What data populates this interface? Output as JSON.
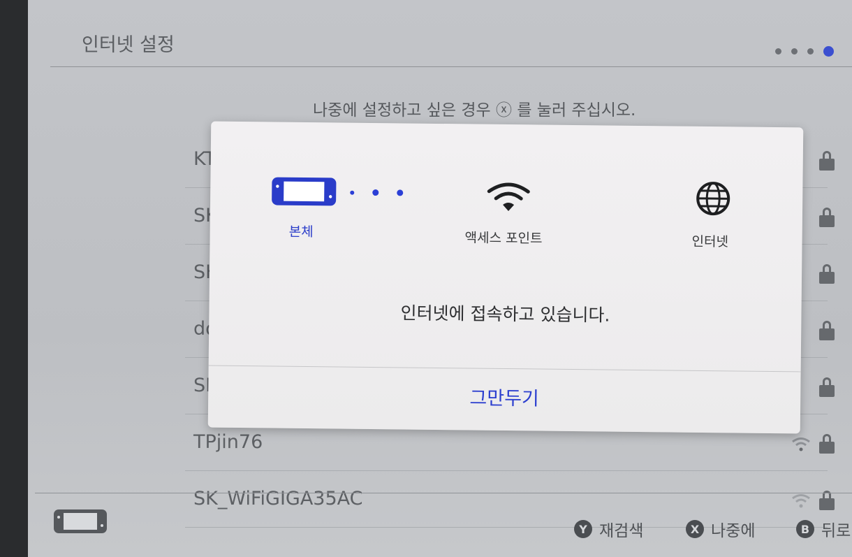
{
  "header": {
    "title": "인터넷 설정",
    "page_dots": 4,
    "active_dot": 4
  },
  "hint": "나중에 설정하고 싶은 경우 ⓧ 를 눌러 주십시오.",
  "networks": [
    {
      "name": "KT"
    },
    {
      "name": "SK"
    },
    {
      "name": "SK"
    },
    {
      "name": "do"
    },
    {
      "name": "SK"
    },
    {
      "name": "TPjin76"
    },
    {
      "name": "SK_WiFiGIGA35AC"
    }
  ],
  "dialog": {
    "console_label": "본체",
    "ap_label": "액세스 포인트",
    "internet_label": "인터넷",
    "message": "인터넷에 접속하고 있습니다.",
    "cancel_label": "그만두기"
  },
  "footer": {
    "buttons": [
      {
        "key": "Y",
        "label": "재검색"
      },
      {
        "key": "X",
        "label": "나중에"
      },
      {
        "key": "B",
        "label": "뒤로"
      }
    ]
  },
  "colors": {
    "accent": "#2c3fcf",
    "background": "#c3c5c9",
    "dialog": "#f0eff0"
  }
}
